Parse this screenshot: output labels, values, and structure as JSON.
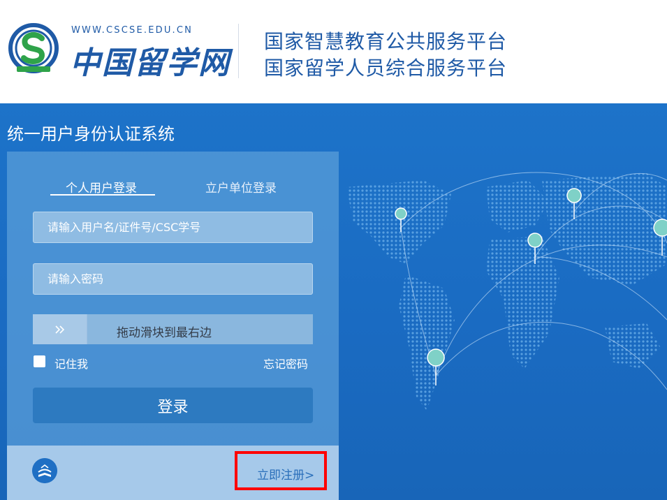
{
  "header": {
    "url_text": "WWW.CSCSE.EDU.CN",
    "site_name": "中国留学网",
    "platform_line_1": "国家智慧教育公共服务平台",
    "platform_line_2": "国家留学人员综合服务平台"
  },
  "banner": {
    "system_title": "统一用户身份认证系统"
  },
  "login": {
    "tabs": [
      {
        "label": "个人用户登录",
        "active": true
      },
      {
        "label": "立户单位登录",
        "active": false
      }
    ],
    "username": {
      "placeholder": "请输入用户名/证件号/CSC学号",
      "value": ""
    },
    "password": {
      "placeholder": "请输入密码",
      "value": ""
    },
    "slider": {
      "handle_icon": "double-chevron-right-icon",
      "label": "拖动滑块到最右边"
    },
    "remember_me": {
      "label": "记住我",
      "checked": false
    },
    "forgot_password": "忘记密码",
    "submit_label": "登录"
  },
  "footer": {
    "icon": "book-globe-icon",
    "register_link": "立即注册>"
  },
  "colors": {
    "brand_blue": "#1f5aa6",
    "banner_blue": "#1a6bc2",
    "login_button": "#2d7ac0",
    "highlight": "#ff0000"
  }
}
